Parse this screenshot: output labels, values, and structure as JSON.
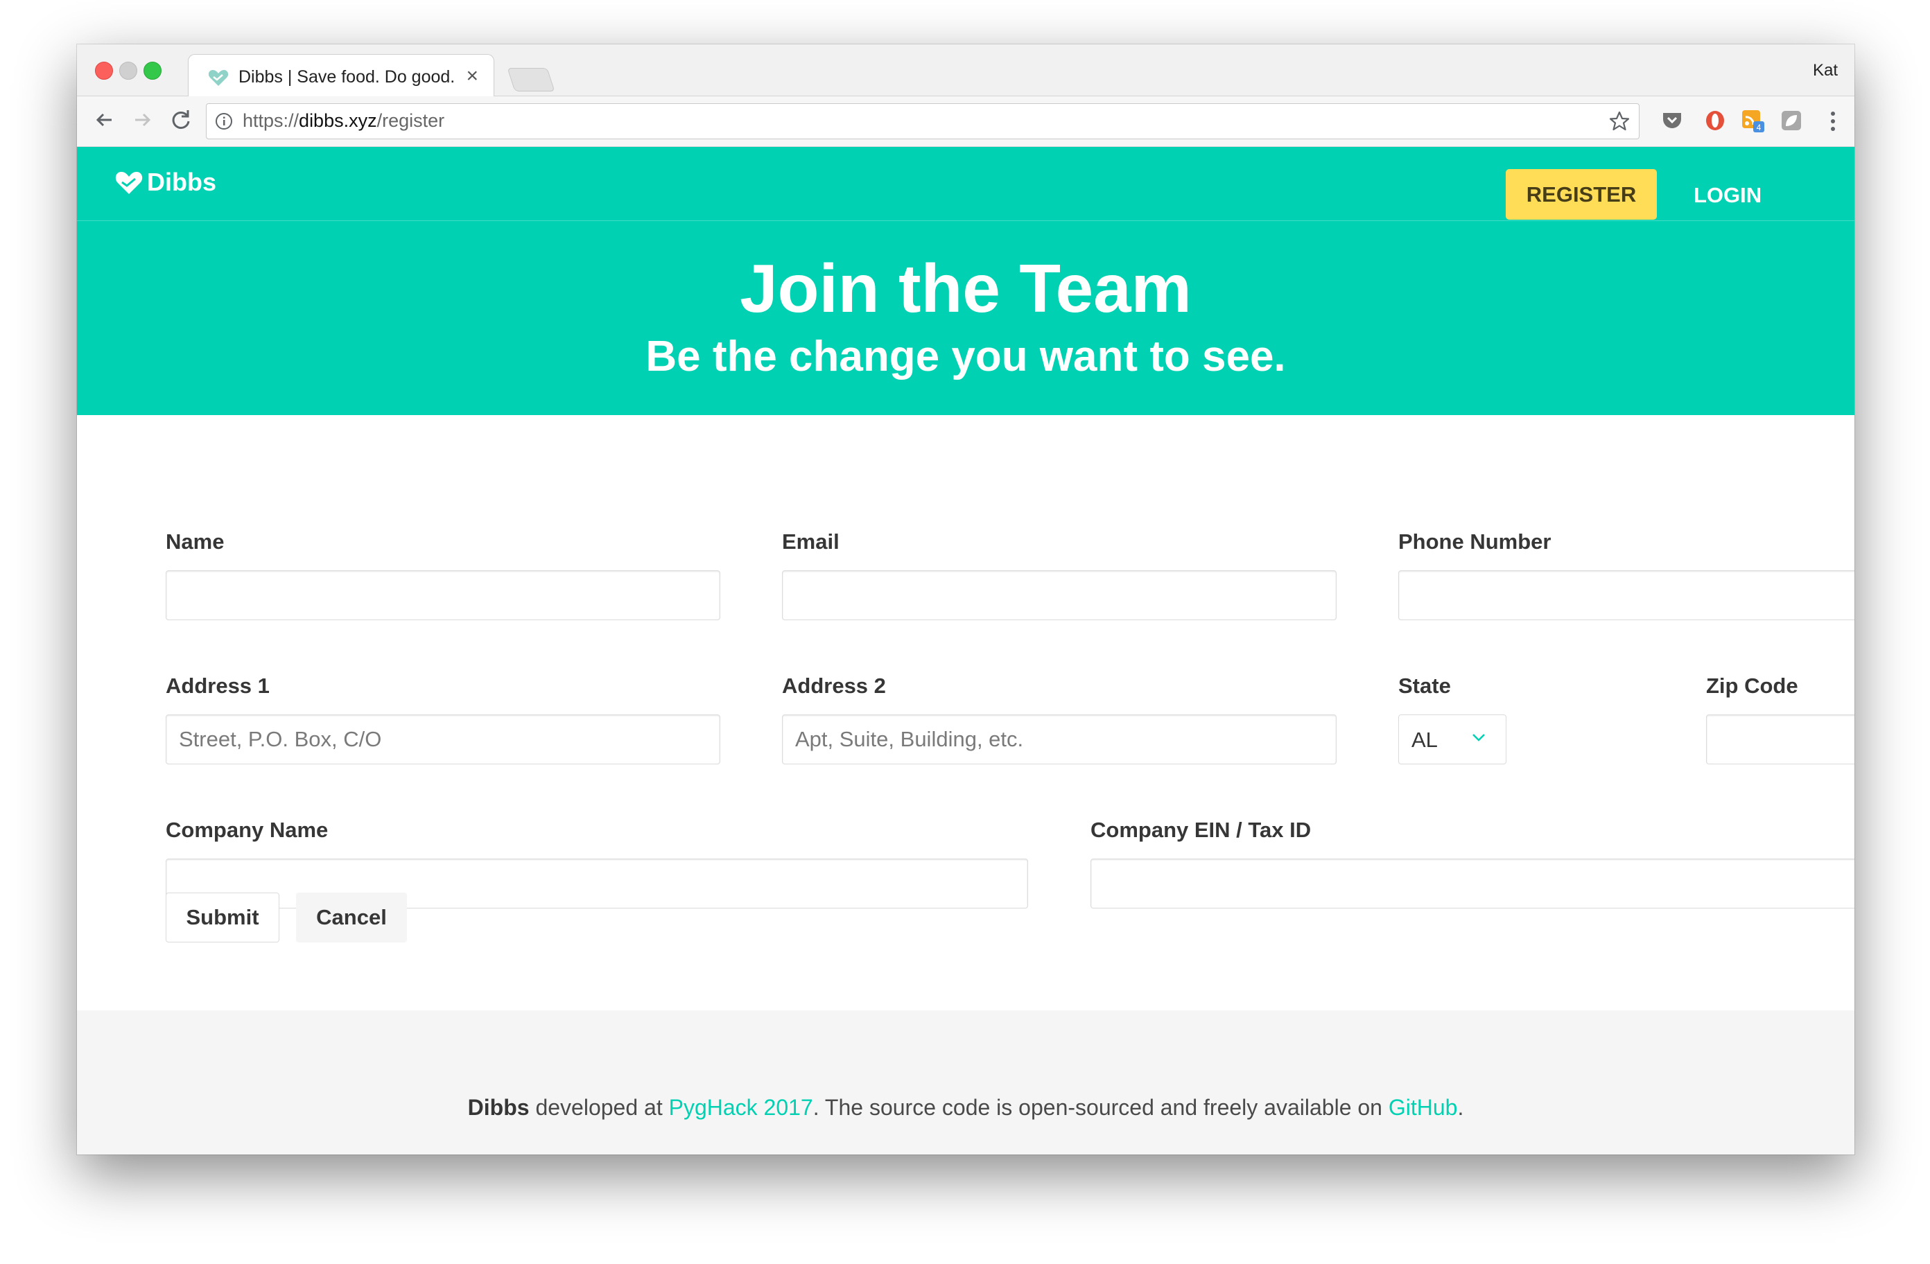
{
  "browser": {
    "tab_title": "Dibbs | Save food. Do good.",
    "tab_close": "×",
    "profile_name": "Kat",
    "url_scheme": "https://",
    "url_host": "dibbs.xyz",
    "url_path": "/register"
  },
  "navbar": {
    "brand": "Dibbs",
    "register_label": "REGISTER",
    "login_label": "LOGIN"
  },
  "hero": {
    "title": "Join the Team",
    "subtitle": "Be the change you want to see."
  },
  "form": {
    "name_label": "Name",
    "email_label": "Email",
    "phone_label": "Phone Number",
    "address1_label": "Address 1",
    "address1_placeholder": "Street, P.O. Box, C/O",
    "address2_label": "Address 2",
    "address2_placeholder": "Apt, Suite, Building, etc.",
    "state_label": "State",
    "state_value": "AL",
    "zip_label": "Zip Code",
    "company_label": "Company Name",
    "ein_label": "Company EIN / Tax ID",
    "submit_label": "Submit",
    "cancel_label": "Cancel"
  },
  "footer": {
    "brand": "Dibbs",
    "text1": " developed at ",
    "pyghack_link": "PygHack 2017",
    "text2": ". The source code is open-sourced and freely available on ",
    "github_link": "GitHub",
    "text3": "."
  },
  "colors": {
    "primary": "#00d1b2",
    "warning": "#ffdd57",
    "text": "#363636"
  },
  "icons": {
    "brand": "heart-hands-icon",
    "back": "arrow-left-icon",
    "forward": "arrow-right-icon",
    "reload": "reload-icon",
    "info": "info-icon",
    "bookmark": "star-icon",
    "pocket": "pocket-icon",
    "opera": "opera-icon",
    "feed": "feed-extension-icon",
    "extension": "extension-icon",
    "menu": "kebab-menu-icon",
    "select": "chevron-down-icon"
  }
}
